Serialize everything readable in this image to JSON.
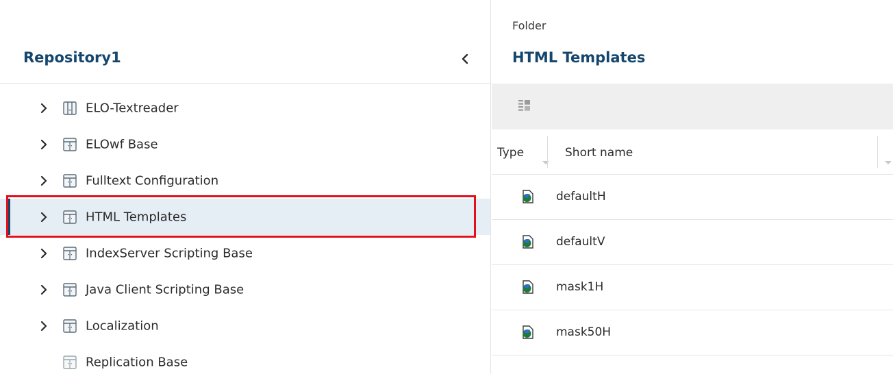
{
  "left_panel": {
    "title": "Repository1",
    "collapse_icon": "chevron-left-icon",
    "tree_items": [
      {
        "label": "ELO-Textreader",
        "icon": "folder-icon",
        "expandable": true
      },
      {
        "label": "ELOwf Base",
        "icon": "folder-icon",
        "expandable": true
      },
      {
        "label": "Fulltext Configuration",
        "icon": "folder-icon",
        "expandable": true
      },
      {
        "label": "HTML Templates",
        "icon": "folder-icon",
        "expandable": true,
        "selected": true
      },
      {
        "label": "IndexServer Scripting Base",
        "icon": "folder-icon",
        "expandable": true
      },
      {
        "label": "Java Client Scripting Base",
        "icon": "folder-icon",
        "expandable": true
      },
      {
        "label": "Localization",
        "icon": "folder-icon",
        "expandable": true
      },
      {
        "label": "Replication Base",
        "icon": "folder-icon",
        "expandable": false
      }
    ]
  },
  "right_panel": {
    "kicker": "Folder",
    "title": "HTML Templates",
    "toolbar": {
      "view_icon": "list-view-icon"
    },
    "columns": [
      "Type",
      "Short name"
    ],
    "rows": [
      {
        "icon": "document-icon",
        "name": "defaultH"
      },
      {
        "icon": "document-icon",
        "name": "defaultV"
      },
      {
        "icon": "document-icon",
        "name": "mask1H"
      },
      {
        "icon": "document-icon",
        "name": "mask50H"
      }
    ]
  },
  "colors": {
    "accent": "#15466e",
    "selection_bg": "#e6eef5",
    "highlight_outline": "#e3101b",
    "toolbar_bg": "#efefef"
  }
}
